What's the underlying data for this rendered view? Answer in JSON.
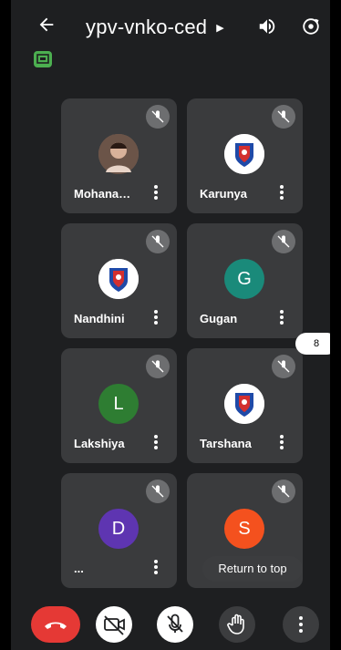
{
  "header": {
    "back_icon": "arrow-left-icon",
    "title": "ypv-vnko-ced",
    "caret_icon": "caret-right-icon",
    "speaker_icon": "speaker-icon",
    "flip_camera_icon": "flip-camera-icon"
  },
  "cast_icon": "cast-icon",
  "participants": [
    {
      "name": "Mohana…",
      "avatar_type": "photo",
      "muted": true
    },
    {
      "name": "Karunya",
      "avatar_type": "logo",
      "muted": true
    },
    {
      "name": "Nandhini",
      "avatar_type": "logo",
      "muted": true
    },
    {
      "name": "Gugan",
      "avatar_type": "letter",
      "letter": "G",
      "color": "#1a8a7a",
      "muted": true
    },
    {
      "name": "Lakshiya",
      "avatar_type": "letter",
      "letter": "L",
      "color": "#2e7d32",
      "muted": true
    },
    {
      "name": "Tarshana",
      "avatar_type": "logo",
      "muted": true
    },
    {
      "name": "...",
      "avatar_type": "letter",
      "letter": "D",
      "color": "#5e35b1",
      "muted": true
    },
    {
      "name": "",
      "avatar_type": "letter",
      "letter": "S",
      "color": "#f4511e",
      "muted": true
    }
  ],
  "return_to_top": "Return to top",
  "page_indicator": "8",
  "controls": {
    "end_call_color": "#e53935",
    "end_call_icon": "phone-hangup-icon",
    "camera_off_icon": "video-off-icon",
    "mic_off_icon": "mic-off-icon",
    "raise_hand_icon": "hand-icon",
    "more_icon": "more-vertical-icon"
  }
}
